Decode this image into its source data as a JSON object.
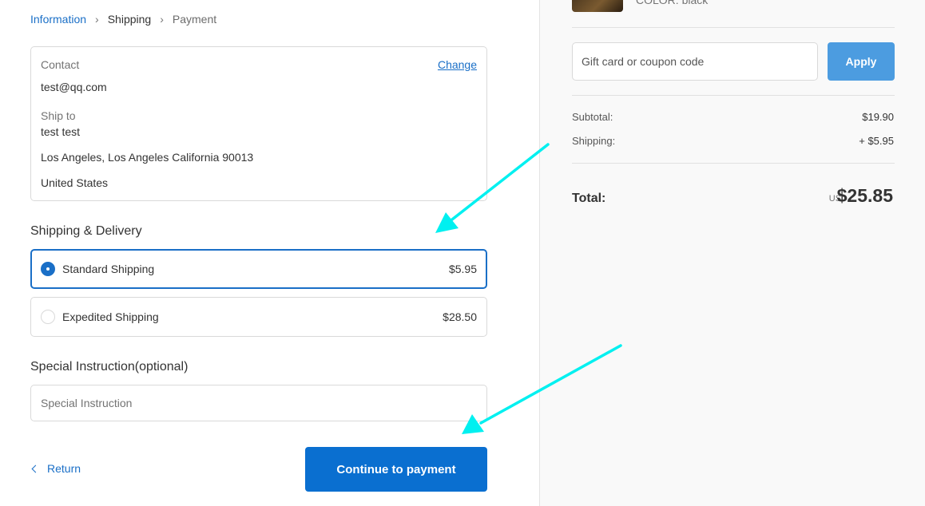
{
  "breadcrumb": {
    "information": "Information",
    "shipping": "Shipping",
    "payment": "Payment"
  },
  "contact": {
    "label": "Contact",
    "value": "test@qq.com",
    "change_label": "Change"
  },
  "ship_to": {
    "label": "Ship to",
    "name": "test test",
    "address": "Los Angeles, Los Angeles California 90013",
    "country": "United States"
  },
  "shipping_section": {
    "title": "Shipping & Delivery",
    "options": [
      {
        "label": "Standard Shipping",
        "price": "$5.95",
        "selected": true
      },
      {
        "label": "Expedited Shipping",
        "price": "$28.50",
        "selected": false
      }
    ]
  },
  "instruction": {
    "title": "Special Instruction(optional)",
    "placeholder": "Special Instruction",
    "value": ""
  },
  "nav": {
    "return_label": "Return",
    "continue_label": "Continue to payment"
  },
  "summary": {
    "item_color": "COLOR: black",
    "coupon_placeholder": "Gift card or coupon code",
    "apply_label": "Apply",
    "subtotal_label": "Subtotal:",
    "subtotal_value": "$19.90",
    "shipping_label": "Shipping:",
    "shipping_value": "+ $5.95",
    "total_label": "Total:",
    "currency": "USD",
    "total_value": "$25.85"
  },
  "colors": {
    "accent": "#0a6fd0",
    "link": "#1a6fc7",
    "apply": "#4c9ce0",
    "annotation_arrow": "#00f0f0"
  },
  "icons": {
    "breadcrumb_separator": "chevron-right-icon",
    "return": "chevron-left-icon",
    "product": "product-thumbnail"
  }
}
